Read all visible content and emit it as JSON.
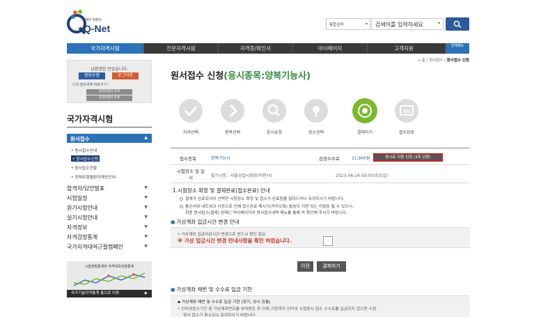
{
  "header": {
    "logo_small": "지혜의 창출원",
    "logo_text": "Q-Net",
    "search_scope": "통합검색",
    "search_placeholder": "검색어를 입력하세요"
  },
  "gnb": {
    "items": [
      "국가자격시험",
      "전문자격시험",
      "자격증/확인서",
      "마이페이지",
      "고객지원"
    ],
    "extra": "전체메뉴"
  },
  "login": {
    "greeting": "님환영합 반갑습니다.",
    "info_button": "정보수정",
    "logout_button": "로그아웃",
    "recent": "나의 접수내역 바로가기",
    "sub1": "응원만큼서 등록",
    "sub2": "응원만큼서 등록"
  },
  "sidebar": {
    "title": "국가자격시험",
    "active_menu": "원서접수",
    "sub_items": [
      "원서접수안내",
      "원서접수신청",
      "원서접수현황",
      "장애유형별편의제공안내"
    ],
    "selected_index": 1,
    "menus": [
      "합격자/답안발표",
      "시험일정",
      "원기시험안내",
      "실기시험안내",
      "자격정보",
      "자격검정통계",
      "국가자격대여근절캠페인"
    ],
    "banner_text": "시험현황통계와 자격취득현황통계",
    "banner_footer": "국가기술자격통계 통으로 이동"
  },
  "breadcrumb": {
    "home": "홈",
    "mid": "원서접수",
    "current": "원서접수 신청"
  },
  "page": {
    "title_prefix": "원서접수 신청",
    "title_suffix": "(응시종목:양복기능사)"
  },
  "steps": [
    {
      "label": "자격선택",
      "icon": "check-icon"
    },
    {
      "label": "종목선택",
      "icon": "arrow-right-icon"
    },
    {
      "label": "응시유형",
      "icon": "magnifier-icon"
    },
    {
      "label": "장소선택",
      "icon": "pin-icon"
    },
    {
      "label": "결제하기",
      "icon": "payment-icon"
    },
    {
      "label": "접수완료",
      "icon": "ok-icon"
    }
  ],
  "info": {
    "item_label": "접수종목",
    "item_value": "양복기능사",
    "fee_label": "검정수수료",
    "fee_value": "11,900원",
    "pay_button": "응시료 지원 신청 (3회 남음)",
    "place_label": "시험장소 및 일시",
    "place_value": "필기시험 : 서울상설시험장(마판사)",
    "place_date": "2023-06-24 09:00(토요일)"
  },
  "notice": {
    "title": "1.시험장소 확정 및 결제완료(접수완료) 안내",
    "line1": "결제가 완료되어야 선택한 시험장소 확정 및 접수가 완료됨을 알려드리니 유의하시기 바랍니다.",
    "line2": "통신사와 네트워크 사정으로 인해 접수완료 메시지(카카오톡) 발송이 지연 되는 미발송 될 수 있으니,",
    "line3": "최종 원서접수(결제) 상태는 마이페이지의 원서접수내역 메뉴를 통해 꼭 확인해 주시기 바랍니다."
  },
  "vaccount": {
    "title": "가상계좌 입금시간 변경 안내",
    "line1": "가상계좌 입금마감시간 변경으로 반드시 확인 필요",
    "warn": "※ 가상 입금시간 변경 안내사항을 확인 하였습니다."
  },
  "buttons": {
    "prev": "이전",
    "pay": "결제하기"
  },
  "refund": {
    "title": "가상계좌 채번 및 수수료 입금 기한",
    "line1": "가상계좌 채번 및 수수료 입금 기한 (정기, 상시 공통)",
    "line2": "인터넷접수기간 중 가상계좌번호를 부여받은 후 아래 기한까지 인터넷 수험원서 접수 수수료를 입금하지 않으면 수험",
    "line3": "원서 접수가 취소되니 유의하시기 바랍니다."
  },
  "colors": {
    "brand_blue": "#2a73b8",
    "accent_green": "#2e8b3a",
    "active_step": "#7ab92c"
  }
}
